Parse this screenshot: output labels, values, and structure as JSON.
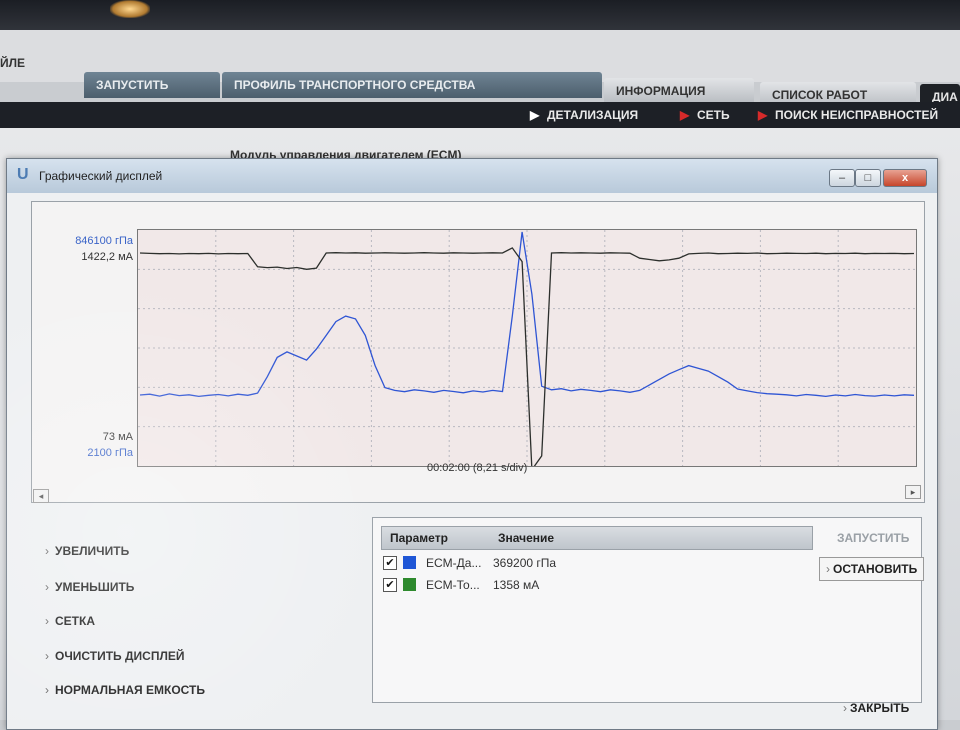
{
  "app": {
    "file_menu": "ЙЛЕ",
    "tabs": [
      {
        "label": "ЗАПУСТИТЬ"
      },
      {
        "label": "ПРОФИЛЬ ТРАНСПОРТНОГО СРЕДСТВА"
      },
      {
        "label": "ИНФОРМАЦИЯ"
      },
      {
        "label": "СПИСОК РАБОТ"
      },
      {
        "label": "ДИА"
      }
    ],
    "subnav": [
      {
        "label": "ДЕТАЛИЗАЦИЯ"
      },
      {
        "label": "СЕТЬ"
      },
      {
        "label": "ПОИСК НЕИСПРАВНОСТЕЙ"
      }
    ],
    "module_title": "Модуль управления двигателем (ECM)"
  },
  "window": {
    "title": "Графический дисплей",
    "minimize": "–",
    "maximize": "□",
    "close": "x"
  },
  "graph": {
    "y_top_blue": "846100 гПа",
    "y_top_dark": "1422,2 мА",
    "y_bottom_dark": "73 мА",
    "y_bottom_blue": "2100 гПа",
    "time_label": "00:02:00 (8,21 s/div)",
    "colors": {
      "series1": "#2f55d4",
      "series2": "#2c2f2c",
      "grid": "#b8b8c0"
    }
  },
  "chart_data": {
    "type": "line",
    "x_divisions": 10,
    "y_divisions": 6,
    "series": [
      {
        "name": "ECM-Да...",
        "unit": "гПа",
        "ylim": [
          2100,
          846100
        ],
        "color": "#2f55d4",
        "values": [
          253000,
          256000,
          249000,
          257000,
          251000,
          254000,
          248000,
          252000,
          255000,
          250000,
          256000,
          252000,
          260000,
          320000,
          390000,
          410000,
          395000,
          380000,
          420000,
          470000,
          520000,
          540000,
          530000,
          470000,
          360000,
          280000,
          270000,
          265000,
          272000,
          268000,
          263000,
          270000,
          266000,
          261000,
          268000,
          264000,
          270000,
          266000,
          540000,
          846100,
          620000,
          285000,
          272000,
          276000,
          268000,
          274000,
          270000,
          265000,
          272000,
          268000,
          263000,
          270000,
          290000,
          310000,
          330000,
          345000,
          360000,
          350000,
          340000,
          320000,
          300000,
          275000,
          268000,
          262000,
          258000,
          256000,
          254000,
          250000,
          255000,
          252000,
          248000,
          253000,
          250000,
          255000,
          251000,
          249000,
          253000,
          250000,
          254000,
          252000
        ]
      },
      {
        "name": "ECM-То...",
        "unit": "мА",
        "ylim": [
          73,
          1422.2
        ],
        "color": "#2c2f2c",
        "values": [
          1300,
          1298,
          1296,
          1297,
          1295,
          1297,
          1296,
          1298,
          1295,
          1297,
          1296,
          1297,
          1220,
          1215,
          1218,
          1210,
          1216,
          1205,
          1212,
          1300,
          1302,
          1300,
          1301,
          1299,
          1300,
          1301,
          1300,
          1299,
          1300,
          1302,
          1300,
          1299,
          1301,
          1300,
          1299,
          1300,
          1301,
          1300,
          1330,
          1250,
          40,
          120,
          1300,
          1302,
          1300,
          1301,
          1300,
          1299,
          1301,
          1300,
          1299,
          1270,
          1262,
          1255,
          1260,
          1270,
          1295,
          1298,
          1300,
          1296,
          1297,
          1299,
          1298,
          1300,
          1296,
          1297,
          1299,
          1298,
          1297,
          1299,
          1296,
          1298,
          1297,
          1299,
          1296,
          1298,
          1297,
          1298,
          1296,
          1297
        ]
      }
    ]
  },
  "menu": [
    {
      "label": "УВЕЛИЧИТЬ"
    },
    {
      "label": "УМЕНЬШИТЬ"
    },
    {
      "label": "СЕТКА"
    },
    {
      "label": "ОЧИСТИТЬ ДИСПЛЕЙ"
    },
    {
      "label": "НОРМАЛЬНАЯ ЕМКОСТЬ"
    }
  ],
  "params": {
    "headers": {
      "param": "Параметр",
      "value": "Значение"
    },
    "rows": [
      {
        "checked": "✔",
        "name": "ECM-Да...",
        "value": "369200 гПа",
        "color": "#1f56d6"
      },
      {
        "checked": "✔",
        "name": "ECM-То...",
        "value": "1358 мА",
        "color": "#2e8a2e"
      }
    ]
  },
  "buttons": {
    "start": "ЗАПУСТИТЬ",
    "stop": "ОСТАНОВИТЬ",
    "close": "ЗАКРЫТЬ"
  }
}
